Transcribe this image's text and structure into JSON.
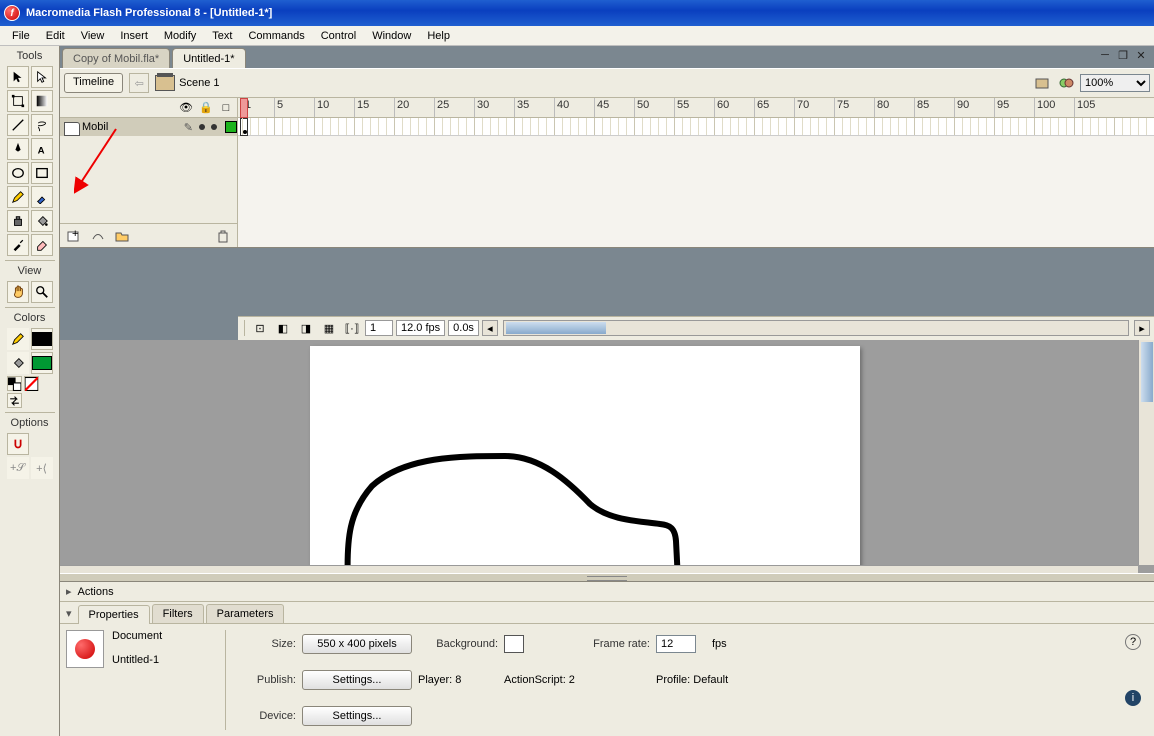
{
  "title": "Macromedia Flash Professional 8 - [Untitled-1*]",
  "menu": [
    "File",
    "Edit",
    "View",
    "Insert",
    "Modify",
    "Text",
    "Commands",
    "Control",
    "Window",
    "Help"
  ],
  "toolsTitle": "Tools",
  "viewTitle": "View",
  "colorsTitle": "Colors",
  "optionsTitle": "Options",
  "tabs": [
    {
      "label": "Copy of Mobil.fla*",
      "active": false
    },
    {
      "label": "Untitled-1*",
      "active": true
    }
  ],
  "timelineBtn": "Timeline",
  "sceneLabel": "Scene 1",
  "zoom": "100%",
  "layer": {
    "name": "Mobil",
    "color": "#1DB31D"
  },
  "ruler": [
    1,
    5,
    10,
    15,
    20,
    25,
    30,
    35,
    40,
    45,
    50,
    55,
    60,
    65,
    70,
    75,
    80,
    85,
    90,
    95,
    100,
    105
  ],
  "status": {
    "frame": "1",
    "fps": "12.0 fps",
    "time": "0.0s"
  },
  "panels": {
    "actions": "Actions",
    "properties": "Properties",
    "filters": "Filters",
    "parameters": "Parameters"
  },
  "props": {
    "docLabel": "Document",
    "docName": "Untitled-1",
    "sizeLabel": "Size:",
    "sizeVal": "550 x 400 pixels",
    "bgLabel": "Background:",
    "frLabel": "Frame rate:",
    "frVal": "12",
    "frUnit": "fps",
    "publishLabel": "Publish:",
    "settingsBtn": "Settings...",
    "playerLabel": "Player: 8",
    "asLabel": "ActionScript: 2",
    "profileLabel": "Profile: Default",
    "deviceLabel": "Device:"
  }
}
